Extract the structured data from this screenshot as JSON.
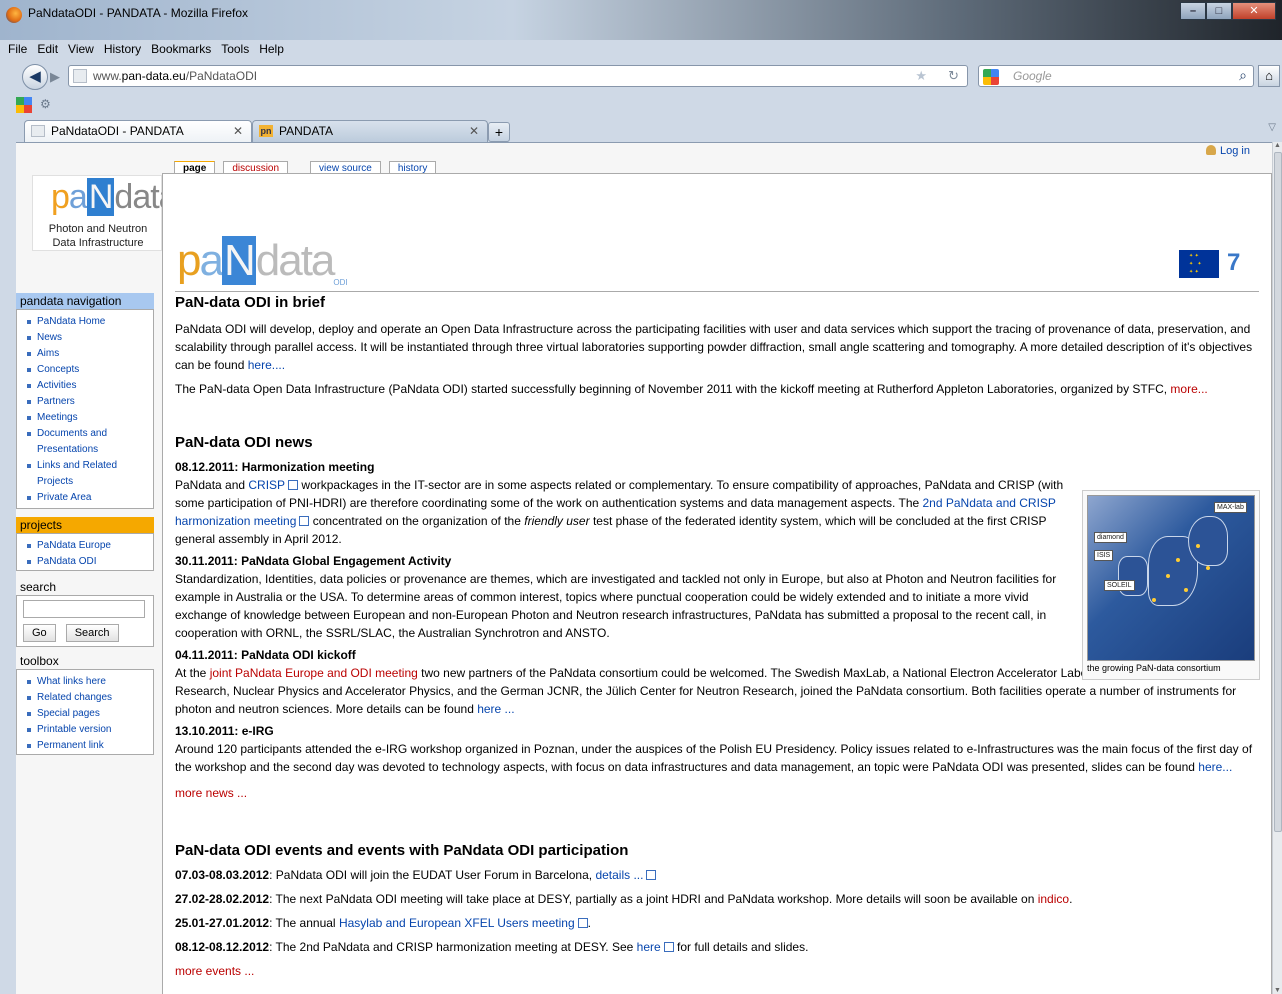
{
  "window": {
    "title": "PaNdataODI - PANDATA - Mozilla Firefox"
  },
  "menu": [
    "File",
    "Edit",
    "View",
    "History",
    "Bookmarks",
    "Tools",
    "Help"
  ],
  "urlbar": {
    "prefix": "www.",
    "domain": "pan-data.eu",
    "path": "/PaNdataODI",
    "search_placeholder": "Google"
  },
  "tabs": [
    {
      "label": "PaNdataODI - PANDATA",
      "active": true
    },
    {
      "label": "PANDATA",
      "active": false
    }
  ],
  "personal": {
    "login": "Log in"
  },
  "logo": {
    "line1": "Photon and Neutron",
    "line2": "Data Infrastructure"
  },
  "sidebar": {
    "nav_title": "pandata navigation",
    "nav_items": [
      "PaNdata Home",
      "News",
      "Aims",
      "Concepts",
      "Activities",
      "Partners",
      "Meetings",
      "Documents and",
      "Presentations",
      "Links and Related",
      "Projects",
      "Private Area"
    ],
    "projects_title": "projects",
    "projects": [
      "PaNdata Europe",
      "PaNdata ODI"
    ],
    "search_title": "search",
    "go_label": "Go",
    "search_label": "Search",
    "toolbox_title": "toolbox",
    "toolbox": [
      "What links here",
      "Related changes",
      "Special pages",
      "Printable version",
      "Permanent link"
    ]
  },
  "page_tabs": [
    "page",
    "discussion",
    "view source",
    "history"
  ],
  "banner": {
    "odi_label": "ODI"
  },
  "sections": {
    "brief_title": "PaN-data ODI in brief",
    "brief_p1a": "PaNdata ODI will develop, deploy and operate an Open Data Infrastructure across the participating facilities with user and data services which support the tracing of provenance of data, preservation, and scalability through parallel access. It will be instantiated through three virtual laboratories supporting powder diffraction, small angle scattering and tomography. A more detailed description of it's objectives can be found ",
    "brief_p1_link": "here....",
    "brief_p2a": "The PaN-data Open Data Infrastructure (PaNdata ODI) started successfully beginning of November 2011 with the kickoff meeting at Rutherford Appleton Laboratories, organized by STFC, ",
    "brief_p2_link": "more...",
    "news_title": "PaN-data ODI news",
    "n1_head": "08.12.2011: Harmonization meeting",
    "n1_a": "PaNdata and ",
    "n1_link1": "CRISP",
    "n1_b": " workpackages in the IT-sector are in some aspects related or complementary. To ensure compatibility of approaches, PaNdata and CRISP (with some participation of PNI-HDRI) are therefore coordinating some of the work on authentication systems and data management aspects. The ",
    "n1_link2": "2nd PaNdata and CRISP harmonization meeting",
    "n1_c": " concentrated on the organization of the ",
    "n1_i": "friendly user",
    "n1_d": " test phase of the federated identity system, which will be concluded at the first CRISP general assembly in April 2012.",
    "n2_head": "30.11.2011: PaNdata Global Engagement Activity",
    "n2_text": "Standardization, Identities, data policies or provenance are themes, which are investigated and tackled not only in Europe, but also at Photon and Neutron facilities for example in Australia or the USA. To determine areas of common interest, topics where punctual cooperation could be widely extended and to initiate a more vivid exchange of knowledge between European and non-European Photon and Neutron research infrastructures, PaNdata has submitted a proposal to the recent call, in cooperation with ORNL, the SSRL/SLAC, the Australian Synchrotron and ANSTO.",
    "n3_head": "04.11.2011: PaNdata ODI kickoff",
    "n3_a": "At the ",
    "n3_link": "joint PaNdata Europe and ODI meeting",
    "n3_b": " two new partners of the PaNdata consortium could be welcomed. The Swedish MaxLab, a National Electron Accelerator Laboratory for Synchrotron Radiation Research, Nuclear Physics and Accelerator Physics, and the German JCNR, the Jülich Center for Neutron Research, joined the PaNdata consortium. Both facilities operate a number of instruments for photon and neutron sciences. More details can be found ",
    "n3_link2": "here ...",
    "n4_head": "13.10.2011: e-IRG",
    "n4_a": "Around 120 participants attended the e-IRG workshop organized in Poznan, under the auspices of the Polish EU Presidency. Policy issues related to e-Infrastructures was the main focus of the first day of the workshop and the second day was devoted to technology aspects, with focus on data infrastructures and data management, an topic were PaNdata ODI was presented, slides can be found ",
    "n4_link": "here...",
    "more_news": "more news ...",
    "thumb_caption": "the growing PaN-data consortium",
    "thumb_labels": [
      "diamond",
      "ISIS",
      "SOLEIL",
      "MAX-lab"
    ],
    "events_title": "PaN-data ODI events and events with PaNdata ODI participation",
    "e1_date": "07.03-08.03.2012",
    "e1_a": ": PaNdata ODI will join the EUDAT User Forum in Barcelona, ",
    "e1_link": "details ...",
    "e2_date": "27.02-28.02.2012",
    "e2_a": ": The next PaNdata ODI meeting will take place at DESY, partially as a joint HDRI and PaNdata workshop. More details will soon be available on ",
    "e2_link": "indico",
    "e2_b": ".",
    "e3_date": "25.01-27.01.2012",
    "e3_a": ": The annual ",
    "e3_link": "Hasylab and European XFEL Users meeting",
    "e3_b": ".",
    "e4_date": "08.12-08.12.2012",
    "e4_a": ": The 2nd PaNdata and CRISP harmonization meeting at DESY. See ",
    "e4_link": "here",
    "e4_b": " for full details and slides.",
    "more_events": "more events ..."
  },
  "colors": {
    "link": "#0645ad",
    "redlink": "#ba0000",
    "nav_head": "#a8c8f0",
    "projects_head": "#f5a800"
  }
}
